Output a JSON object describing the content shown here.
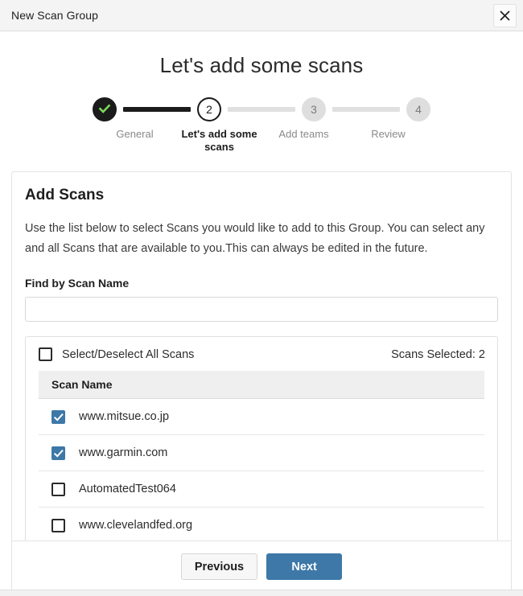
{
  "window": {
    "title": "New Scan Group",
    "close_icon": "close-icon"
  },
  "page": {
    "heading": "Let's add some scans"
  },
  "stepper": {
    "steps": [
      {
        "number": "1",
        "label": "General",
        "state": "done",
        "check_icon": "check-icon"
      },
      {
        "number": "2",
        "label": "Let's add some scans",
        "state": "current"
      },
      {
        "number": "3",
        "label": "Add teams",
        "state": "upcoming"
      },
      {
        "number": "4",
        "label": "Review",
        "state": "upcoming"
      }
    ]
  },
  "card": {
    "title": "Add Scans",
    "description": "Use the list below to select Scans you would like to add to this Group. You can select any and all Scans that are available to you.This can always be edited in the future.",
    "search": {
      "label": "Find by Scan Name",
      "value": "",
      "placeholder": ""
    },
    "list": {
      "select_all_label": "Select/Deselect All Scans",
      "select_all_checked": false,
      "selected_count_text": "Scans Selected: 2",
      "column_header": "Scan Name",
      "rows": [
        {
          "name": "www.mitsue.co.jp",
          "checked": true
        },
        {
          "name": "www.garmin.com",
          "checked": true
        },
        {
          "name": "AutomatedTest064",
          "checked": false
        },
        {
          "name": "www.clevelandfed.org",
          "checked": false
        }
      ]
    },
    "footer": {
      "previous_label": "Previous",
      "next_label": "Next"
    }
  },
  "colors": {
    "accent_blue": "#3d78a8",
    "check_green": "#7ed957",
    "step_dark": "#1b1b1b",
    "step_gray": "#dedede"
  }
}
